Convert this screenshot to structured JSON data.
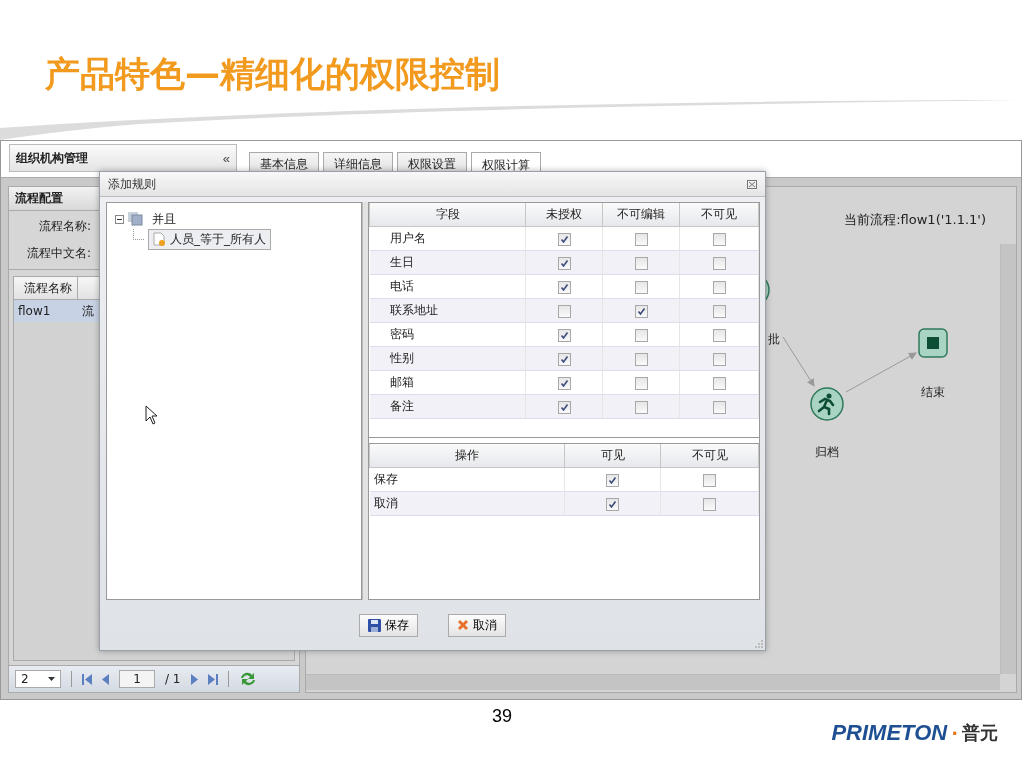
{
  "slide": {
    "title": "产品特色—精细化的权限控制",
    "page_number": "39",
    "logo": {
      "brand": "PRIMETON",
      "separator": "·",
      "name": "普元"
    }
  },
  "app": {
    "left_header": {
      "title": "组织机构管理",
      "collapse": "«"
    },
    "tabs": [
      {
        "label": "基本信息",
        "selected": false
      },
      {
        "label": "详细信息",
        "selected": false
      },
      {
        "label": "权限设置",
        "selected": false
      },
      {
        "label": "权限计算",
        "selected": true
      }
    ],
    "flow_panel": {
      "title": "流程配置",
      "fields": [
        {
          "label": "流程名称:"
        },
        {
          "label": "流程中文名:"
        }
      ],
      "grid": {
        "columns": [
          "流程名称"
        ],
        "rows": [
          {
            "cells": [
              "flow1",
              "流"
            ],
            "selected": true
          }
        ]
      },
      "pager": {
        "page_size": "2",
        "page": "1",
        "total": "/ 1"
      }
    },
    "canvas": {
      "current_flow": "当前流程:flow1('1.1.1')",
      "nodes": [
        {
          "kind": "activity",
          "label": "批"
        },
        {
          "kind": "activity",
          "label": "归档"
        },
        {
          "kind": "end",
          "label": "结束"
        }
      ]
    }
  },
  "dialog": {
    "title": "添加规则",
    "tree": [
      {
        "label": "并且",
        "expanded": true,
        "selected": false,
        "children": [
          {
            "label": "人员_等于_所有人",
            "selected": true
          }
        ]
      }
    ],
    "field_table": {
      "columns": [
        "字段",
        "未授权",
        "不可编辑",
        "不可见"
      ],
      "rows": [
        {
          "field": "用户名",
          "checks": [
            true,
            false,
            false
          ]
        },
        {
          "field": "生日",
          "checks": [
            true,
            false,
            false
          ]
        },
        {
          "field": "电话",
          "checks": [
            true,
            false,
            false
          ]
        },
        {
          "field": "联系地址",
          "checks": [
            false,
            true,
            false
          ]
        },
        {
          "field": "密码",
          "checks": [
            true,
            false,
            false
          ]
        },
        {
          "field": "性别",
          "checks": [
            true,
            false,
            false
          ]
        },
        {
          "field": "邮箱",
          "checks": [
            true,
            false,
            false
          ]
        },
        {
          "field": "备注",
          "checks": [
            true,
            false,
            false
          ]
        }
      ]
    },
    "action_table": {
      "columns": [
        "操作",
        "可见",
        "不可见"
      ],
      "rows": [
        {
          "action": "保存",
          "checks": [
            true,
            false
          ]
        },
        {
          "action": "取消",
          "checks": [
            true,
            false
          ]
        }
      ]
    },
    "buttons": [
      {
        "kind": "save",
        "label": "保存"
      },
      {
        "kind": "cancel",
        "label": "取消"
      }
    ]
  }
}
